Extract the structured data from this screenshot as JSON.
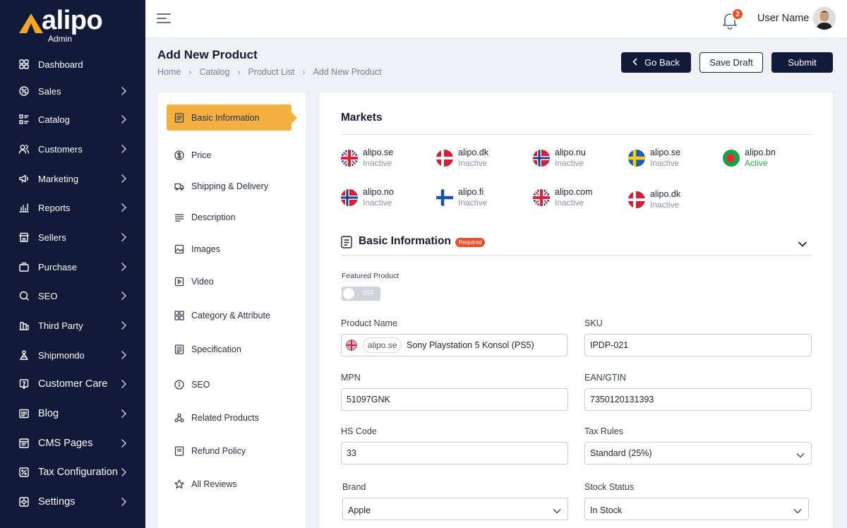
{
  "app": {
    "logo_text": "alipo",
    "logo_sub": "Admin",
    "user_name": "User Name",
    "notification_count": "2"
  },
  "sidebar": {
    "items": [
      {
        "label": "Dashboard",
        "icon": "dashboard-icon",
        "has_chevron": false
      },
      {
        "label": "Sales",
        "icon": "sales-icon",
        "has_chevron": true
      },
      {
        "label": "Catalog",
        "icon": "catalog-icon",
        "has_chevron": true
      },
      {
        "label": "Customers",
        "icon": "customers-icon",
        "has_chevron": true
      },
      {
        "label": "Marketing",
        "icon": "marketing-icon",
        "has_chevron": true
      },
      {
        "label": "Reports",
        "icon": "reports-icon",
        "has_chevron": true
      },
      {
        "label": "Sellers",
        "icon": "sellers-icon",
        "has_chevron": true
      },
      {
        "label": "Purchase",
        "icon": "purchase-icon",
        "has_chevron": true
      },
      {
        "label": "SEO",
        "icon": "seo-icon",
        "has_chevron": true
      },
      {
        "label": "Third Party",
        "icon": "third-party-icon",
        "has_chevron": true
      },
      {
        "label": "Shipmondo",
        "icon": "shipmondo-icon",
        "has_chevron": true
      },
      {
        "label": "Customer Care",
        "icon": "customer-care-icon",
        "has_chevron": true
      },
      {
        "label": "Blog",
        "icon": "blog-icon",
        "has_chevron": true
      },
      {
        "label": "CMS Pages",
        "icon": "cms-pages-icon",
        "has_chevron": true
      },
      {
        "label": "Tax Configuration",
        "icon": "tax-configuration-icon",
        "has_chevron": true
      },
      {
        "label": "Settings",
        "icon": "settings-icon",
        "has_chevron": true
      }
    ]
  },
  "page": {
    "title": "Add New Product",
    "breadcrumb": [
      "Home",
      "Catalog",
      "Product List",
      "Add New Product"
    ],
    "go_back_label": "Go Back",
    "save_draft_label": "Save Draft",
    "submit_label": "Submit"
  },
  "sections": {
    "items": [
      {
        "label": "Basic Information",
        "icon": "document-icon"
      },
      {
        "label": "Price",
        "icon": "dollar-icon"
      },
      {
        "label": "Shipping & Delivery",
        "icon": "truck-icon"
      },
      {
        "label": "Description",
        "icon": "lines-icon"
      },
      {
        "label": "Images",
        "icon": "image-icon"
      },
      {
        "label": "Video",
        "icon": "video-icon"
      },
      {
        "label": "Category & Attribute",
        "icon": "grid-icon"
      },
      {
        "label": "Specification",
        "icon": "list-icon"
      },
      {
        "label": "SEO",
        "icon": "info-icon"
      },
      {
        "label": "Related Products",
        "icon": "related-icon"
      },
      {
        "label": "Refund Policy",
        "icon": "refund-icon"
      },
      {
        "label": "All Reviews",
        "icon": "star-icon"
      }
    ]
  },
  "markets": {
    "title": "Markets",
    "items": [
      {
        "name": "alipo.se",
        "status": "Inactive",
        "flag": "uk"
      },
      {
        "name": "alipo.dk",
        "status": "Inactive",
        "flag": "dk"
      },
      {
        "name": "alipo.nu",
        "status": "Inactive",
        "flag": "no"
      },
      {
        "name": "alipo.se",
        "status": "Inactive",
        "flag": "se"
      },
      {
        "name": "alipo.bn",
        "status": "Active",
        "flag": "bd"
      },
      {
        "name": "alipo.no",
        "status": "Inactive",
        "flag": "no"
      },
      {
        "name": "alipo.fi",
        "status": "Inactive",
        "flag": "fi"
      },
      {
        "name": "alipo.com",
        "status": "Inactive",
        "flag": "uk"
      },
      {
        "name": "alipo.dk",
        "status": "Inactive",
        "flag": "dk"
      }
    ]
  },
  "basic_info": {
    "title": "Basic Information",
    "required_badge": "Required",
    "featured_label": "Featured Product",
    "featured_state": "OFF",
    "product_name_label": "Product Name",
    "product_name_market": "alipo.se",
    "product_name_value": "Sony Playstation 5 Konsol (PS5)",
    "sku_label": "SKU",
    "sku_value": "IPDP-021",
    "mpn_label": "MPN",
    "mpn_value": "51097GNK",
    "ean_label": "EAN/GTIN",
    "ean_value": "7350120131393",
    "hs_label": "HS Code",
    "hs_value": "33",
    "tax_label": "Tax Rules",
    "tax_value": "Standard (25%)",
    "brand_label": "Brand",
    "brand_value": "Apple",
    "stock_label": "Stock Status",
    "stock_value": "In Stock"
  },
  "colors": {
    "sidebar_bg": "#121a39",
    "accent": "#f5b042",
    "badge": "#e8522a",
    "active_status": "#27a844"
  }
}
